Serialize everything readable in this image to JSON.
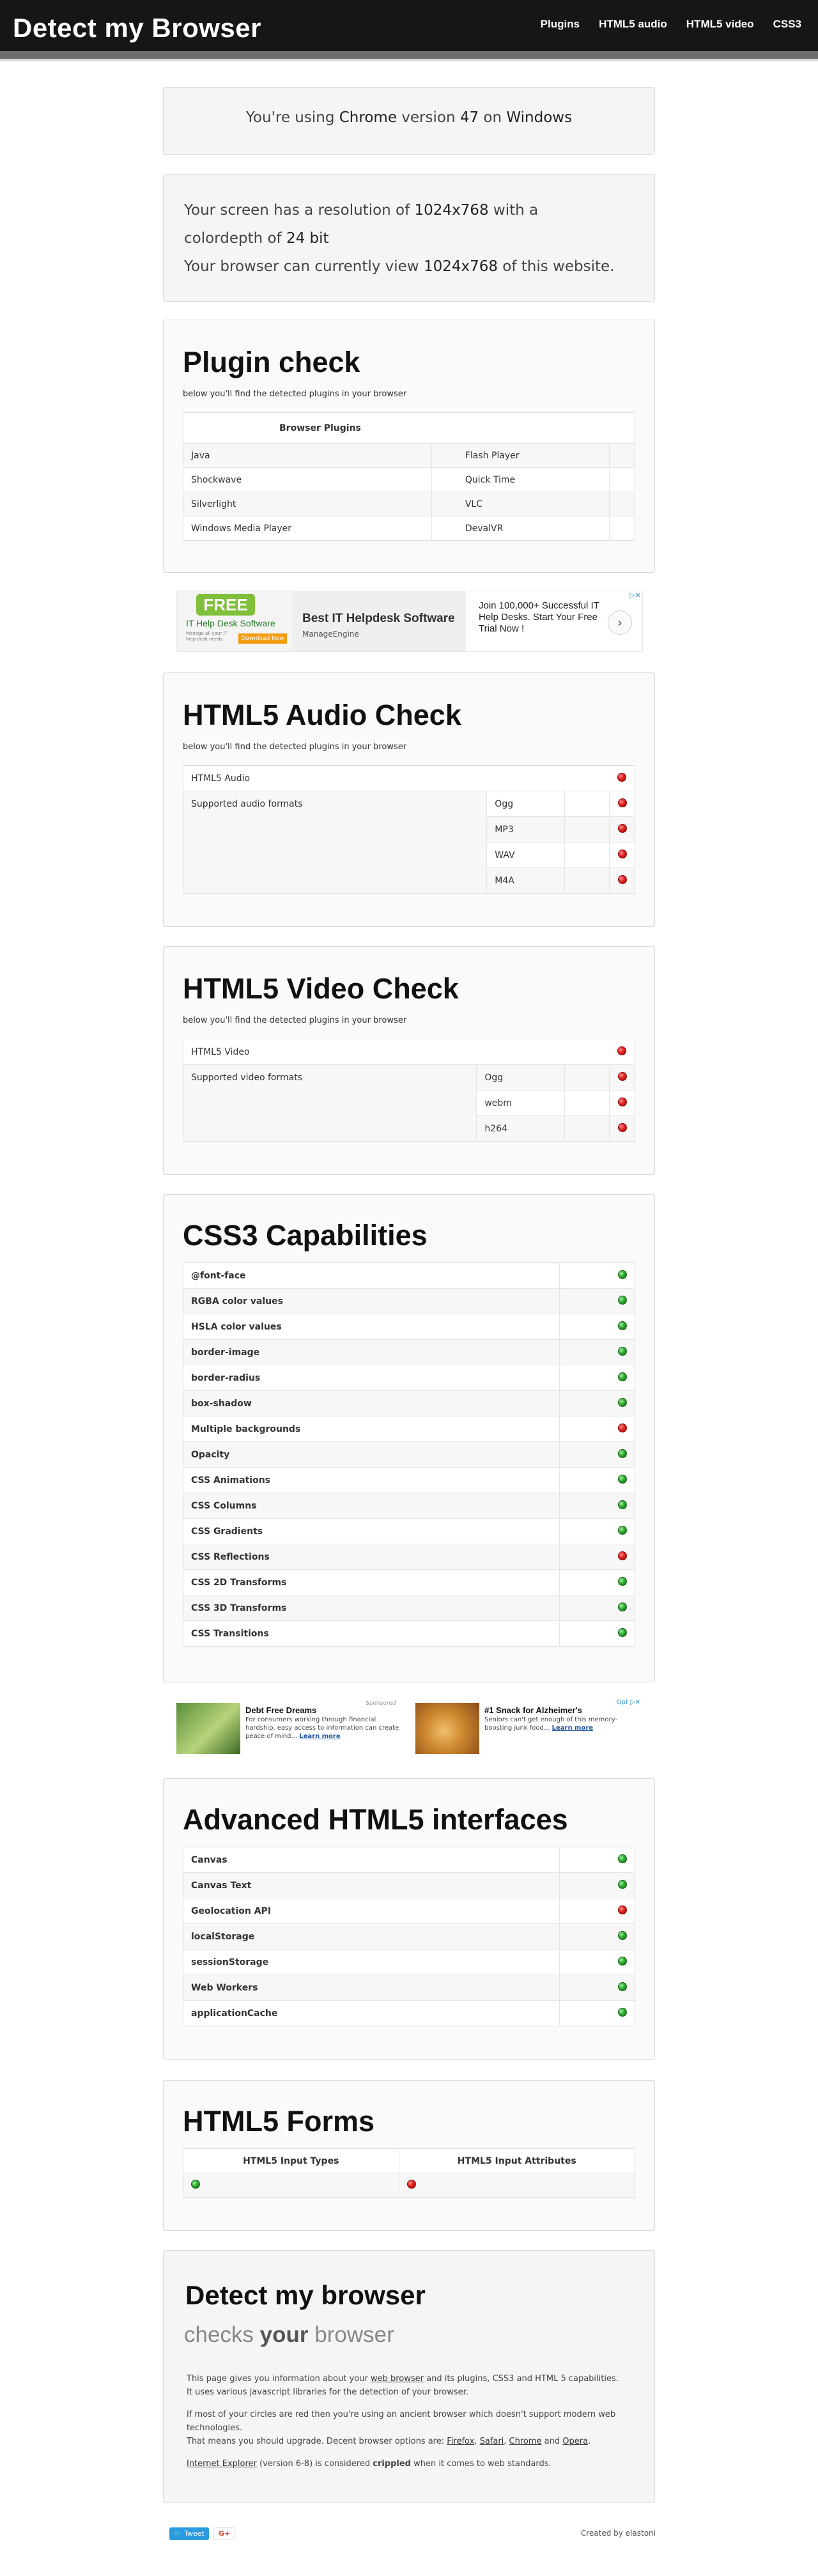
{
  "nav": {
    "brand": "Detect my Browser",
    "links": [
      "Plugins",
      "HTML5 audio",
      "HTML5 video",
      "CSS3"
    ]
  },
  "browser_box": {
    "prefix": "You're using ",
    "browser": "Chrome",
    "mid": " version ",
    "version": "47",
    "mid2": " on ",
    "os": "Windows"
  },
  "screen_box": {
    "l1a": "Your screen has a resolution of ",
    "resolution": "1024x768",
    "l1b": " with a",
    "l2a": "colordepth of ",
    "depth": "24 bit",
    "l3a": "Your browser can currently view ",
    "view": "1024x768",
    "l3b": " of this website."
  },
  "plugins": {
    "title": "Plugin check",
    "subtitle": "below you'll find the detected plugins in your browser",
    "header": "Browser Plugins",
    "rows": [
      [
        "Java",
        "Flash Player"
      ],
      [
        "Shockwave",
        "Quick Time"
      ],
      [
        "Silverlight",
        "VLC"
      ],
      [
        "Windows Media Player",
        "DevalVR"
      ]
    ]
  },
  "ad1": {
    "logo": "FREE",
    "logo_sub": "IT Help Desk Software",
    "tiny": "Manage all your IT help desk needs",
    "badge": "Download Now",
    "title": "Best IT Helpdesk Software",
    "by": "ManageEngine",
    "text": "Join 100,000+ Successful IT Help Desks. Start Your Free Trial Now !",
    "adchoice": "▷✕"
  },
  "audio": {
    "title": "HTML5 Audio Check",
    "subtitle": "below you'll find the detected plugins in your browser",
    "main_label": "HTML5 Audio",
    "formats_label": "Supported audio formats",
    "formats": [
      "Ogg",
      "MP3",
      "WAV",
      "M4A"
    ]
  },
  "video": {
    "title": "HTML5 Video Check",
    "subtitle": "below you'll find the detected plugins in your browser",
    "main_label": "HTML5 Video",
    "formats_label": "Supported video formats",
    "formats": [
      "Ogg",
      "webm",
      "h264"
    ]
  },
  "css3": {
    "title": "CSS3 Capabilities",
    "items": [
      {
        "label": "@font-face",
        "status": "green"
      },
      {
        "label": "RGBA color values",
        "status": "green"
      },
      {
        "label": "HSLA color values",
        "status": "green"
      },
      {
        "label": "border-image",
        "status": "green"
      },
      {
        "label": "border-radius",
        "status": "green"
      },
      {
        "label": "box-shadow",
        "status": "green"
      },
      {
        "label": "Multiple backgrounds",
        "status": "red"
      },
      {
        "label": "Opacity",
        "status": "green"
      },
      {
        "label": "CSS Animations",
        "status": "green"
      },
      {
        "label": "CSS Columns",
        "status": "green"
      },
      {
        "label": "CSS Gradients",
        "status": "green"
      },
      {
        "label": "CSS Reflections",
        "status": "red"
      },
      {
        "label": "CSS 2D Transforms",
        "status": "green"
      },
      {
        "label": "CSS 3D Transforms",
        "status": "green"
      },
      {
        "label": "CSS Transitions",
        "status": "green"
      }
    ]
  },
  "ad2": {
    "sponsored": "Sponsored",
    "ad_a_title": "Debt Free Dreams",
    "ad_a_text": "For consumers working through financial hardship, easy access to information can create peace of mind...",
    "ad_a_link": "Learn more",
    "ad_b_title": "#1 Snack for Alzheimer's",
    "ad_b_text": "Seniors can't get enough of this memory-boosting junk food...",
    "ad_b_link": "Learn more",
    "ad_choice": "Opt ▷✕"
  },
  "html5": {
    "title": "Advanced HTML5 interfaces",
    "items": [
      {
        "label": "Canvas",
        "status": "green"
      },
      {
        "label": "Canvas Text",
        "status": "green"
      },
      {
        "label": "Geolocation API",
        "status": "red"
      },
      {
        "label": "localStorage",
        "status": "green"
      },
      {
        "label": "sessionStorage",
        "status": "green"
      },
      {
        "label": "Web Workers",
        "status": "green"
      },
      {
        "label": "applicationCache",
        "status": "green"
      }
    ]
  },
  "forms": {
    "title": "HTML5 Forms",
    "col1": "HTML5 Input Types",
    "col2": "HTML5 Input Attributes",
    "col1_status": "green",
    "col2_status": "red"
  },
  "about": {
    "title": "Detect my browser",
    "tag_a": "checks ",
    "tag_b": "your",
    "tag_c": " browser",
    "p1a": "This page gives you information about your ",
    "p1link": "web browser",
    "p1b": " and its plugins, CSS3 and HTML 5 capabilities. It uses various javascript libraries for the detection of your browser.",
    "p2": "If most of your circles are red then you're using an ancient browser which doesn't support modern web technologies.",
    "p3a": "That means you should upgrade. Decent browser options are: ",
    "b1": "Firefox",
    "b2": "Safari",
    "b3": "Chrome",
    "b4": "Opera",
    "p4link": "Internet Explorer",
    "p4a": " (version 6-8) is considered ",
    "p4b": "crippled",
    "p4c": " when it comes to web standards."
  },
  "footer": {
    "tweet": "Tweet",
    "gplus": "G+",
    "credit": "Created by elastoni"
  },
  "colors": {
    "red": "#e02020",
    "green": "#2eaa2e",
    "topbar": "#161616"
  }
}
